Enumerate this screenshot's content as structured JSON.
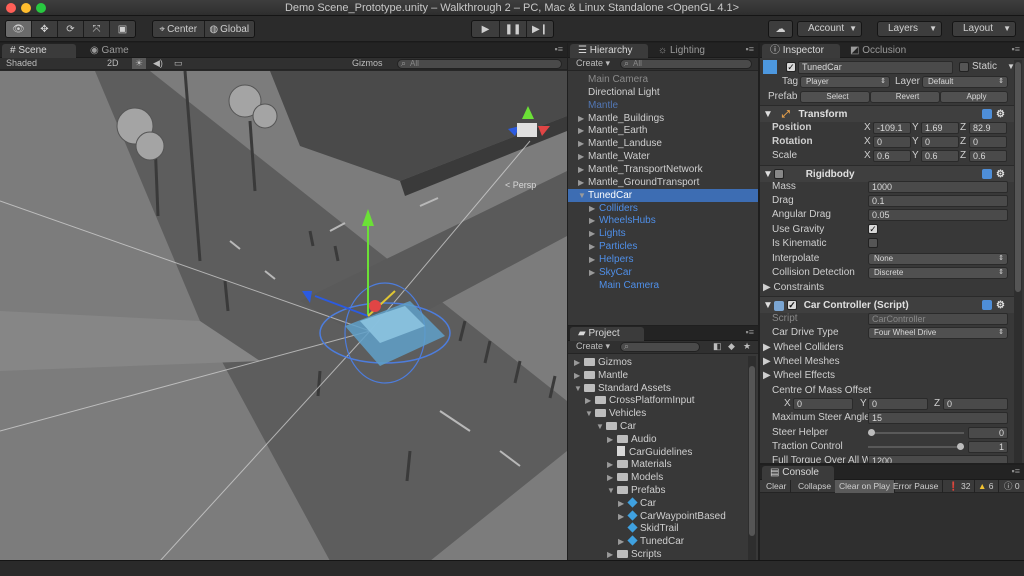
{
  "window": {
    "title": "Demo Scene_Prototype.unity – Walkthrough 2 – PC, Mac & Linux Standalone <OpenGL 4.1>"
  },
  "toolbar": {
    "center_label": "Center",
    "global_label": "Global",
    "account_label": "Account",
    "layers_label": "Layers",
    "layout_label": "Layout"
  },
  "scene": {
    "tab_scene": "Scene",
    "tab_game": "Game",
    "shading_mode": "Shaded",
    "mode_2d": "2D",
    "gizmos_label": "Gizmos",
    "search_placeholder": "All",
    "persp_label": "< Persp"
  },
  "hierarchy": {
    "tab_hierarchy": "Hierarchy",
    "tab_lighting": "Lighting",
    "create_label": "Create",
    "search_placeholder": "All",
    "items": [
      {
        "label": "Main Camera",
        "indent": 0,
        "arrow": false
      },
      {
        "label": "Directional Light",
        "indent": 0,
        "arrow": false
      },
      {
        "label": "Mantle",
        "indent": 0,
        "arrow": false
      },
      {
        "label": "Mantle_Buildings",
        "indent": 0,
        "arrow": true
      },
      {
        "label": "Mantle_Earth",
        "indent": 0,
        "arrow": true
      },
      {
        "label": "Mantle_Landuse",
        "indent": 0,
        "arrow": true
      },
      {
        "label": "Mantle_Water",
        "indent": 0,
        "arrow": true
      },
      {
        "label": "Mantle_TransportNetwork",
        "indent": 0,
        "arrow": true
      },
      {
        "label": "Mantle_GroundTransport",
        "indent": 0,
        "arrow": true
      },
      {
        "label": "TunedCar",
        "indent": 0,
        "arrow": true
      },
      {
        "label": "Colliders",
        "indent": 1,
        "arrow": true
      },
      {
        "label": "WheelsHubs",
        "indent": 1,
        "arrow": true
      },
      {
        "label": "Lights",
        "indent": 1,
        "arrow": true
      },
      {
        "label": "Particles",
        "indent": 1,
        "arrow": true
      },
      {
        "label": "Helpers",
        "indent": 1,
        "arrow": true
      },
      {
        "label": "SkyCar",
        "indent": 1,
        "arrow": true
      },
      {
        "label": "Main Camera",
        "indent": 1,
        "arrow": false
      }
    ]
  },
  "project": {
    "tab_project": "Project",
    "create_label": "Create",
    "items": [
      {
        "label": "Gizmos",
        "indent": 0,
        "arrow": "right",
        "icon": "folder"
      },
      {
        "label": "Mantle",
        "indent": 0,
        "arrow": "right",
        "icon": "folder"
      },
      {
        "label": "Standard Assets",
        "indent": 0,
        "arrow": "down",
        "icon": "folder"
      },
      {
        "label": "CrossPlatformInput",
        "indent": 1,
        "arrow": "right",
        "icon": "folder"
      },
      {
        "label": "Vehicles",
        "indent": 1,
        "arrow": "down",
        "icon": "folder"
      },
      {
        "label": "Car",
        "indent": 2,
        "arrow": "down",
        "icon": "folder"
      },
      {
        "label": "Audio",
        "indent": 3,
        "arrow": "right",
        "icon": "folder"
      },
      {
        "label": "CarGuidelines",
        "indent": 3,
        "arrow": "",
        "icon": "file"
      },
      {
        "label": "Materials",
        "indent": 3,
        "arrow": "right",
        "icon": "folder"
      },
      {
        "label": "Models",
        "indent": 3,
        "arrow": "right",
        "icon": "folder"
      },
      {
        "label": "Prefabs",
        "indent": 3,
        "arrow": "down",
        "icon": "folder"
      },
      {
        "label": "Car",
        "indent": 4,
        "arrow": "right",
        "icon": "prefab"
      },
      {
        "label": "CarWaypointBased",
        "indent": 4,
        "arrow": "right",
        "icon": "prefab"
      },
      {
        "label": "SkidTrail",
        "indent": 4,
        "arrow": "",
        "icon": "prefab"
      },
      {
        "label": "TunedCar",
        "indent": 4,
        "arrow": "right",
        "icon": "prefab"
      },
      {
        "label": "Scripts",
        "indent": 3,
        "arrow": "right",
        "icon": "folder"
      }
    ]
  },
  "inspector": {
    "tab_inspector": "Inspector",
    "tab_occlusion": "Occlusion",
    "object_name": "TunedCar",
    "static_label": "Static",
    "tag_label": "Tag",
    "tag_value": "Player",
    "layer_label": "Layer",
    "layer_value": "Default",
    "prefab_label": "Prefab",
    "prefab_select": "Select",
    "prefab_revert": "Revert",
    "prefab_apply": "Apply",
    "transform": {
      "title": "Transform",
      "position_label": "Position",
      "rotation_label": "Rotation",
      "scale_label": "Scale",
      "position": {
        "x": "-109.1",
        "y": "1.69",
        "z": "82.9"
      },
      "rotation": {
        "x": "0",
        "y": "0",
        "z": "0"
      },
      "scale": {
        "x": "0.6",
        "y": "0.6",
        "z": "0.6"
      }
    },
    "rigidbody": {
      "title": "Rigidbody",
      "mass_label": "Mass",
      "mass": "1000",
      "drag_label": "Drag",
      "drag": "0.1",
      "angular_drag_label": "Angular Drag",
      "angular_drag": "0.05",
      "use_gravity_label": "Use Gravity",
      "is_kinematic_label": "Is Kinematic",
      "interpolate_label": "Interpolate",
      "interpolate_value": "None",
      "collision_label": "Collision Detection",
      "collision_value": "Discrete",
      "constraints_label": "Constraints"
    },
    "car_controller": {
      "title": "Car Controller (Script)",
      "script_label": "Script",
      "script_value": "CarController",
      "drive_type_label": "Car Drive Type",
      "drive_type_value": "Four Wheel Drive",
      "wheel_colliders_label": "Wheel Colliders",
      "wheel_meshes_label": "Wheel Meshes",
      "wheel_effects_label": "Wheel Effects",
      "com_offset_label": "Centre Of Mass Offset",
      "com": {
        "x": "0",
        "y": "0",
        "z": "0"
      },
      "max_steer_label": "Maximum Steer Angle",
      "max_steer": "15",
      "steer_helper_label": "Steer Helper",
      "steer_helper": "0",
      "steer_helper_level": 0,
      "traction_label": "Traction Control",
      "traction": "1",
      "traction_level": 1,
      "full_torque_label": "Full Torque Over All W",
      "full_torque": "1200"
    }
  },
  "console": {
    "tab_console": "Console",
    "clear": "Clear",
    "collapse": "Collapse",
    "clear_on_play": "Clear on Play",
    "error_pause": "Error Pause",
    "log_count": "32",
    "warning_count": "6",
    "error_count": "0"
  },
  "colors": {
    "selection_blue": "#3d6db3",
    "prefab_text_blue": "#4f8fe8",
    "panel_bg": "#383838"
  }
}
